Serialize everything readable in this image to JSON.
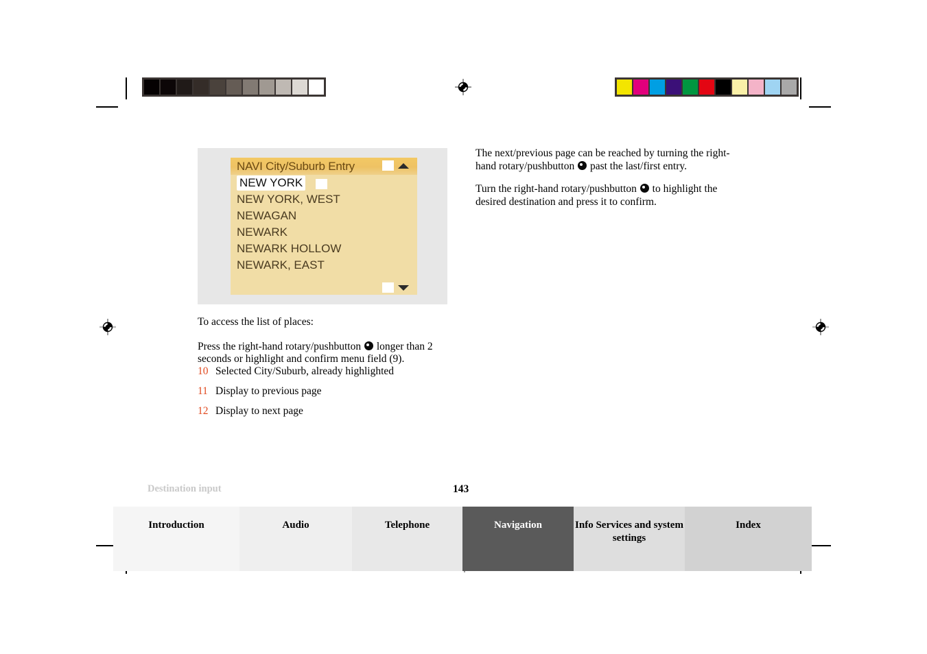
{
  "document": {
    "footer_chapter_label": "Destination input",
    "page_number": "143"
  },
  "calibration": {
    "gray_strip_name": "grayscale-calibration-strip",
    "gray_patches": [
      "#050102",
      "#0c0607",
      "#201a18",
      "#342c28",
      "#4a423c",
      "#655c55",
      "#827a73",
      "#a09992",
      "#bfb9b3",
      "#ddd9d4",
      "#ffffff"
    ],
    "color_strip_name": "color-calibration-strip",
    "color_patches": [
      "#f3e500",
      "#e2007c",
      "#009fe3",
      "#3b1078",
      "#009640",
      "#e30613",
      "#000000",
      "#faf0a8",
      "#f4b3c8",
      "#9fd4f2",
      "#a9a9a9"
    ]
  },
  "figure": {
    "caption_id": "navi-city-suburb-entry-screen",
    "header_title": "NAVI City/Suburb Entry",
    "list_items": [
      {
        "label": "NEW YORK",
        "selected": true
      },
      {
        "label": "NEW YORK, WEST",
        "selected": false
      },
      {
        "label": "NEWAGAN",
        "selected": false
      },
      {
        "label": "NEWARK",
        "selected": false
      },
      {
        "label": "NEWARK HOLLOW",
        "selected": false
      },
      {
        "label": "NEWARK, EAST",
        "selected": false
      }
    ],
    "scroll_up_icon": "triangle-up-icon",
    "scroll_down_icon": "triangle-down-icon"
  },
  "right_column": {
    "paragraph_1_part_a": "The next/previous page can be reached by turning the right-hand rotary/pushbutton",
    "paragraph_1_part_b": "past the last/first entry.",
    "paragraph_2_part_a": "Turn the right-hand rotary/pushbutton",
    "paragraph_2_part_b": "to highlight the desired destination and press it to confirm."
  },
  "left_column": {
    "intro": "To access the list of places:",
    "instruction_part_a": "Press the right-hand rotary/pushbutton",
    "instruction_part_b": "longer than 2 seconds or highlight and confirm menu field (9)."
  },
  "legend": {
    "items": [
      {
        "number": "10",
        "text": "Selected City/Suburb, already highlighted"
      },
      {
        "number": "11",
        "text": "Display to previous page"
      },
      {
        "number": "12",
        "text": "Display to next page"
      }
    ],
    "number_color": "#e1491f"
  },
  "tabbar": {
    "tabs": [
      {
        "label": "Introduction",
        "bg": "#f5f5f5",
        "fg": "#000000",
        "active": false
      },
      {
        "label": "Audio",
        "bg": "#efefef",
        "fg": "#000000",
        "active": false
      },
      {
        "label": "Telephone",
        "bg": "#e8e8e8",
        "fg": "#000000",
        "active": false
      },
      {
        "label": "Navigation",
        "bg": "#5a5a5a",
        "fg": "#ffffff",
        "active": true
      },
      {
        "label": "Info Services and system settings",
        "bg": "#dedede",
        "fg": "#000000",
        "active": false
      },
      {
        "label": "Index",
        "bg": "#d2d2d2",
        "fg": "#000000",
        "active": false
      }
    ]
  }
}
